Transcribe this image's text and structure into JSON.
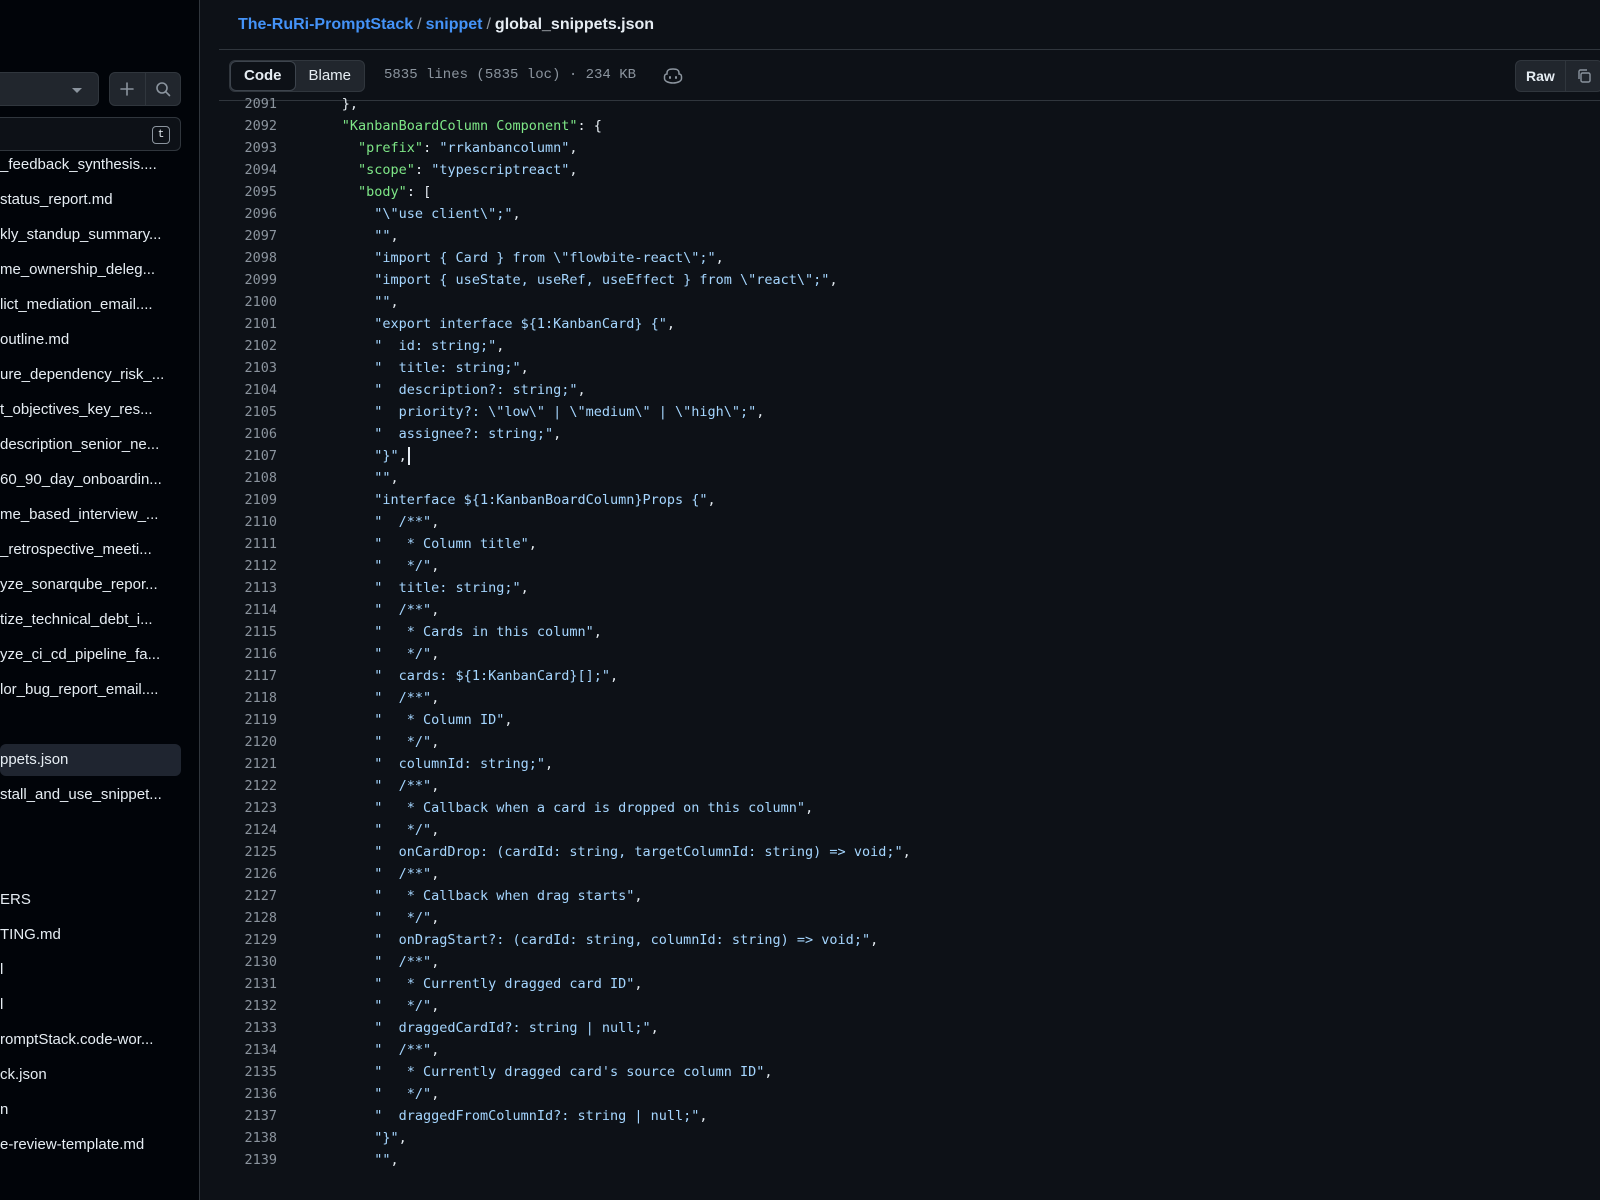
{
  "sidebar": {
    "filter_shortcut": "t",
    "files": [
      "_feedback_synthesis....",
      "status_report.md",
      "kly_standup_summary...",
      "me_ownership_deleg...",
      "lict_mediation_email....",
      "outline.md",
      "ure_dependency_risk_...",
      "t_objectives_key_res...",
      "description_senior_ne...",
      "60_90_day_onboardin...",
      "me_based_interview_...",
      "_retrospective_meeti...",
      "yze_sonarqube_repor...",
      "tize_technical_debt_i...",
      "yze_ci_cd_pipeline_fa...",
      "lor_bug_report_email....",
      "ppets.json",
      "stall_and_use_snippet...",
      "ERS",
      "TING.md",
      "l",
      "l",
      "romptStack.code-wor...",
      "ck.json",
      "n",
      "e-review-template.md"
    ]
  },
  "breadcrumb": {
    "repo": "The-RuRi-PromptStack",
    "sep": "/",
    "folder": "snippet",
    "file": "global_snippets.json"
  },
  "file_header": {
    "code_tab": "Code",
    "blame_tab": "Blame",
    "meta": "5835 lines (5835 loc) · 234 KB",
    "raw_button": "Raw"
  },
  "code_lines": [
    {
      "n": "2091",
      "t": "      },"
    },
    {
      "n": "2092",
      "t": "      \"KanbanBoardColumn Component\": {"
    },
    {
      "n": "2093",
      "t": "        \"prefix\": \"rrkanbancolumn\","
    },
    {
      "n": "2094",
      "t": "        \"scope\": \"typescriptreact\","
    },
    {
      "n": "2095",
      "t": "        \"body\": ["
    },
    {
      "n": "2096",
      "t": "          \"\\\"use client\\\";\","
    },
    {
      "n": "2097",
      "t": "          \"\","
    },
    {
      "n": "2098",
      "t": "          \"import { Card } from \\\"flowbite-react\\\";\","
    },
    {
      "n": "2099",
      "t": "          \"import { useState, useRef, useEffect } from \\\"react\\\";\","
    },
    {
      "n": "2100",
      "t": "          \"\","
    },
    {
      "n": "2101",
      "t": "          \"export interface ${1:KanbanCard} {\","
    },
    {
      "n": "2102",
      "t": "          \"  id: string;\","
    },
    {
      "n": "2103",
      "t": "          \"  title: string;\","
    },
    {
      "n": "2104",
      "t": "          \"  description?: string;\","
    },
    {
      "n": "2105",
      "t": "          \"  priority?: \\\"low\\\" | \\\"medium\\\" | \\\"high\\\";\","
    },
    {
      "n": "2106",
      "t": "          \"  assignee?: string;\","
    },
    {
      "n": "2107",
      "t": "          \"}\","
    },
    {
      "n": "2108",
      "t": "          \"\","
    },
    {
      "n": "2109",
      "t": "          \"interface ${1:KanbanBoardColumn}Props {\","
    },
    {
      "n": "2110",
      "t": "          \"  /**\","
    },
    {
      "n": "2111",
      "t": "          \"   * Column title\","
    },
    {
      "n": "2112",
      "t": "          \"   */\","
    },
    {
      "n": "2113",
      "t": "          \"  title: string;\","
    },
    {
      "n": "2114",
      "t": "          \"  /**\","
    },
    {
      "n": "2115",
      "t": "          \"   * Cards in this column\","
    },
    {
      "n": "2116",
      "t": "          \"   */\","
    },
    {
      "n": "2117",
      "t": "          \"  cards: ${1:KanbanCard}[];\","
    },
    {
      "n": "2118",
      "t": "          \"  /**\","
    },
    {
      "n": "2119",
      "t": "          \"   * Column ID\","
    },
    {
      "n": "2120",
      "t": "          \"   */\","
    },
    {
      "n": "2121",
      "t": "          \"  columnId: string;\","
    },
    {
      "n": "2122",
      "t": "          \"  /**\","
    },
    {
      "n": "2123",
      "t": "          \"   * Callback when a card is dropped on this column\","
    },
    {
      "n": "2124",
      "t": "          \"   */\","
    },
    {
      "n": "2125",
      "t": "          \"  onCardDrop: (cardId: string, targetColumnId: string) => void;\","
    },
    {
      "n": "2126",
      "t": "          \"  /**\","
    },
    {
      "n": "2127",
      "t": "          \"   * Callback when drag starts\","
    },
    {
      "n": "2128",
      "t": "          \"   */\","
    },
    {
      "n": "2129",
      "t": "          \"  onDragStart?: (cardId: string, columnId: string) => void;\","
    },
    {
      "n": "2130",
      "t": "          \"  /**\","
    },
    {
      "n": "2131",
      "t": "          \"   * Currently dragged card ID\","
    },
    {
      "n": "2132",
      "t": "          \"   */\","
    },
    {
      "n": "2133",
      "t": "          \"  draggedCardId?: string | null;\","
    },
    {
      "n": "2134",
      "t": "          \"  /**\","
    },
    {
      "n": "2135",
      "t": "          \"   * Currently dragged card's source column ID\","
    },
    {
      "n": "2136",
      "t": "          \"   */\","
    },
    {
      "n": "2137",
      "t": "          \"  draggedFromColumnId?: string | null;\","
    },
    {
      "n": "2138",
      "t": "          \"}\","
    },
    {
      "n": "2139",
      "t": "          \"\","
    }
  ]
}
